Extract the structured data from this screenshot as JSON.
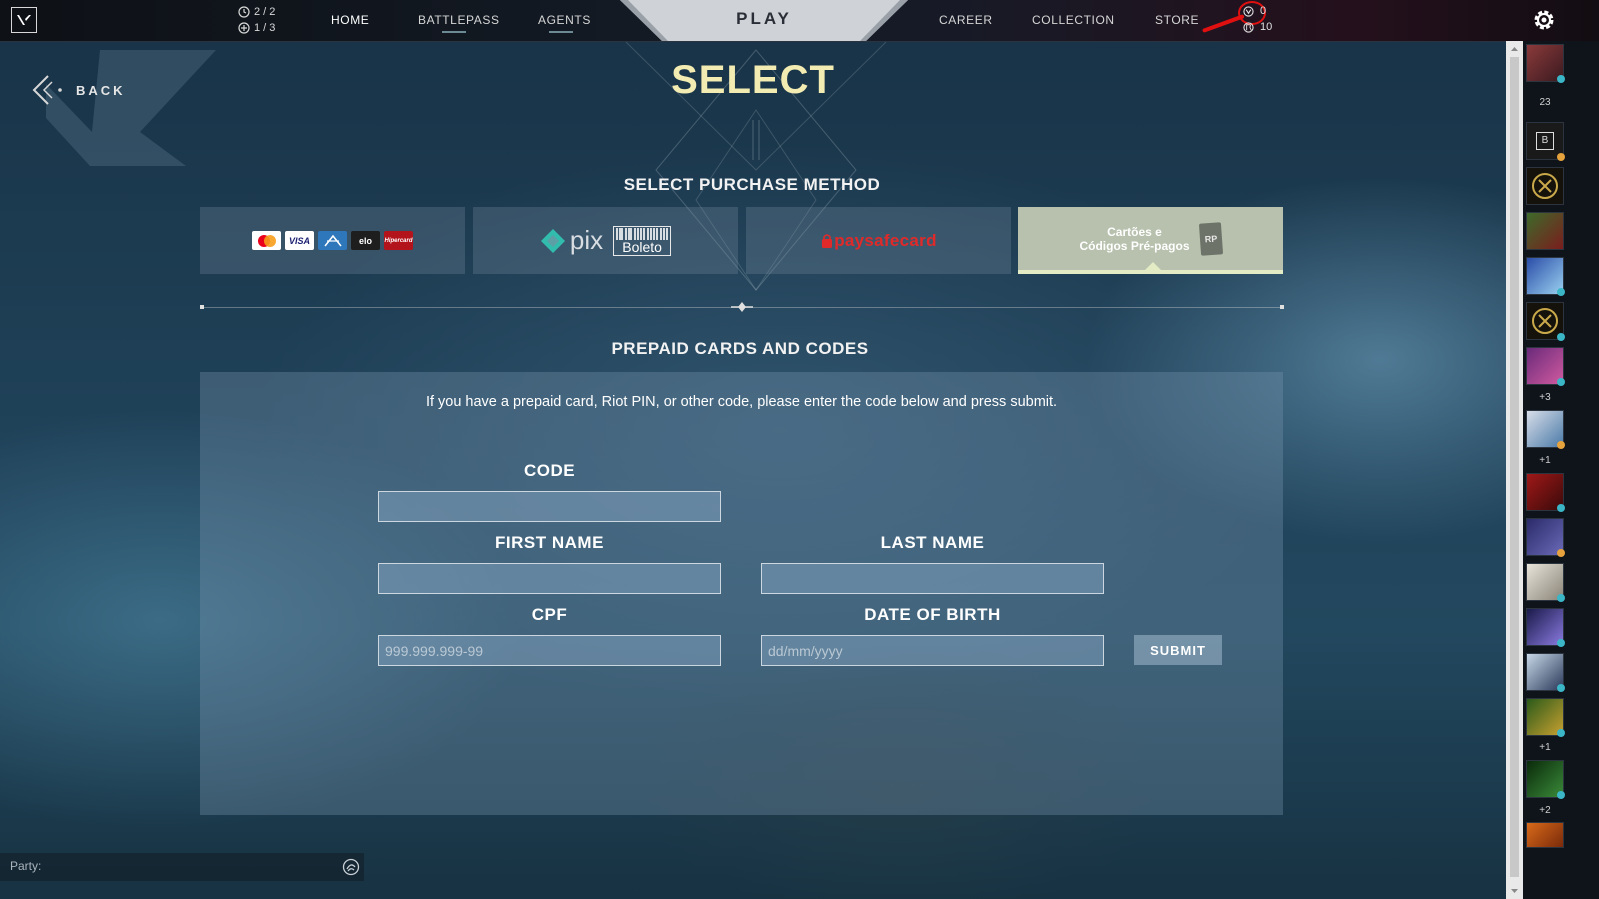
{
  "topbar": {
    "counter_1": "2 / 2",
    "counter_2": "1 / 3",
    "nav_left": [
      "HOME",
      "BATTLEPASS",
      "AGENTS"
    ],
    "play": "PLAY",
    "nav_right": [
      "CAREER",
      "COLLECTION",
      "STORE"
    ],
    "valorant_points": "0",
    "radianite_points": "10"
  },
  "back_label": "BACK",
  "page_title": "SELECT",
  "purchase_method": {
    "heading": "SELECT PURCHASE METHOD",
    "card_logos": [
      "VISA",
      "elo",
      "Hipercard"
    ],
    "pix_label": "pix",
    "boleto_label": "Boleto",
    "paysafe_label": "paysafecard",
    "prepaid_label_line1": "Cartões e",
    "prepaid_label_line2": "Códigos Pré-pagos",
    "prepaid_badge": "RP"
  },
  "form": {
    "heading": "PREPAID CARDS AND CODES",
    "info": "If you have a prepaid card, Riot PIN, or other code, please enter the code below and press submit.",
    "code_label": "CODE",
    "first_name_label": "FIRST NAME",
    "last_name_label": "LAST NAME",
    "cpf_label": "CPF",
    "cpf_placeholder": "999.999.999-99",
    "dob_label": "DATE OF BIRTH",
    "dob_placeholder": "dd/mm/yyyy",
    "submit": "SUBMIT"
  },
  "party_label": "Party:",
  "social": {
    "online_count": "23",
    "group_counts": [
      "+3",
      "+1",
      "+1",
      "+2"
    ],
    "status_colors": [
      "#3bb6c7",
      "#e6a23c"
    ]
  }
}
